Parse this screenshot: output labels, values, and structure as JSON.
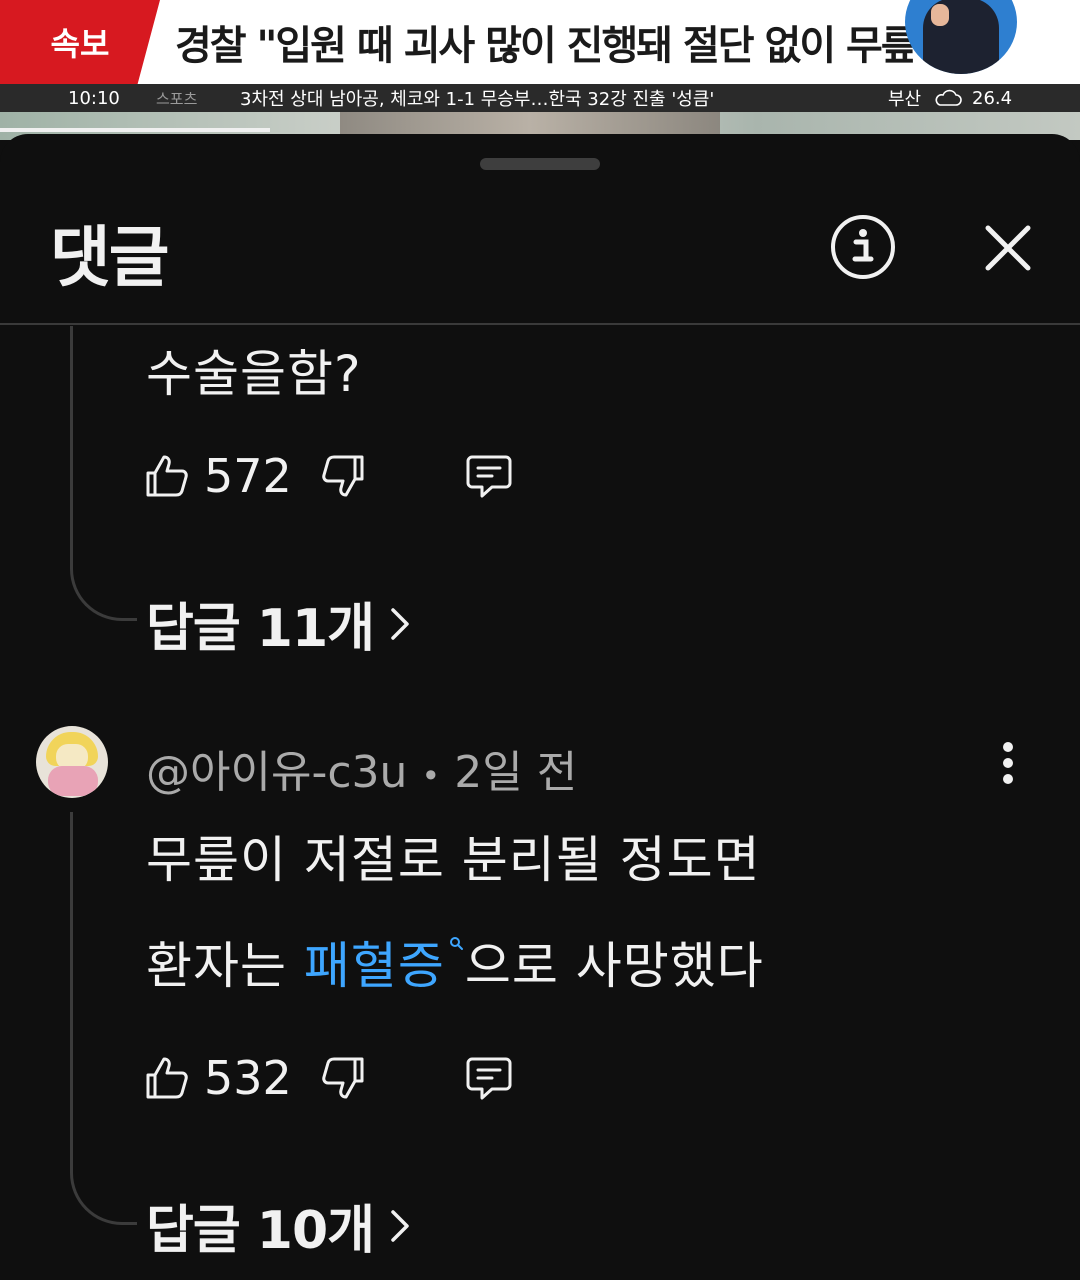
{
  "video": {
    "breaking_label": "속보",
    "headline": "경찰 \"입원 때 괴사 많이 진행돼 절단 없이 무릎 분리\"",
    "ticker": {
      "time": "10:10",
      "category": "스포츠",
      "news": "3차전 상대 남아공, 체코와 1-1 무승부…한국 32강 진출 '성큼'",
      "location": "부산",
      "temperature": "26.4"
    },
    "progress_fraction": 0.25
  },
  "sheet": {
    "title": "댓글",
    "info_icon": "info-circle-icon",
    "close_icon": "close-icon"
  },
  "comments": [
    {
      "text_lines": [
        "수술을함?"
      ],
      "likes": "572",
      "replies_label": "답글 11개"
    },
    {
      "author": "@아이유-c3u",
      "separator": "•",
      "time": "2일 전",
      "text_line1": "무릎이 저절로 분리될 정도면",
      "text_line2_before": "환자는 ",
      "text_line2_link": "패혈증",
      "text_line2_after": "으로 사망했다",
      "likes": "532",
      "replies_label": "답글 10개"
    }
  ],
  "colors": {
    "background": "#0f0f0f",
    "link": "#3ea6ff",
    "breaking_red": "#d71920",
    "meta_gray": "#aaaaaa"
  }
}
